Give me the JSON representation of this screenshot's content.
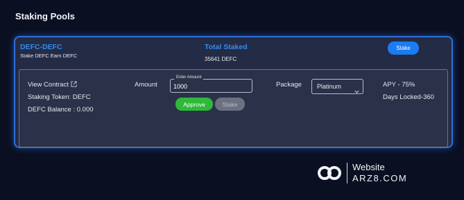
{
  "page": {
    "title": "Staking Pools"
  },
  "pool": {
    "name": "DEFC-DEFC",
    "description": "Stake DEFC Earn DEFC",
    "total_staked_label": "Total Staked",
    "total_staked_value": "35641 DEFC",
    "stake_button": "Stake",
    "view_contract": "View Contract",
    "staking_token": "Staking Token: DEFC",
    "balance": "DEFC Balance : 0.000",
    "amount_label": "Amount",
    "amount_field_label": "Enter Amount",
    "amount_value": "1000",
    "approve_button": "Approve",
    "stake_disabled_button": "Stake",
    "package_label": "Package",
    "package_selected": "Platinum",
    "apy": "APY - 75%",
    "days_locked": "Days Locked-360"
  },
  "watermark": {
    "line1": "Website",
    "line2": "ARZ8.COM"
  },
  "icons": {
    "external_link": "external-link-icon",
    "dropdown": "chevron-down-icon",
    "logo": "website-logo-icon"
  },
  "colors": {
    "background": "#0a0f22",
    "card": "#242b45",
    "accent": "#2f8df5",
    "stake_button": "#1a7cf0",
    "approve_button": "#2fb83a",
    "disabled_button": "#6d7080"
  }
}
